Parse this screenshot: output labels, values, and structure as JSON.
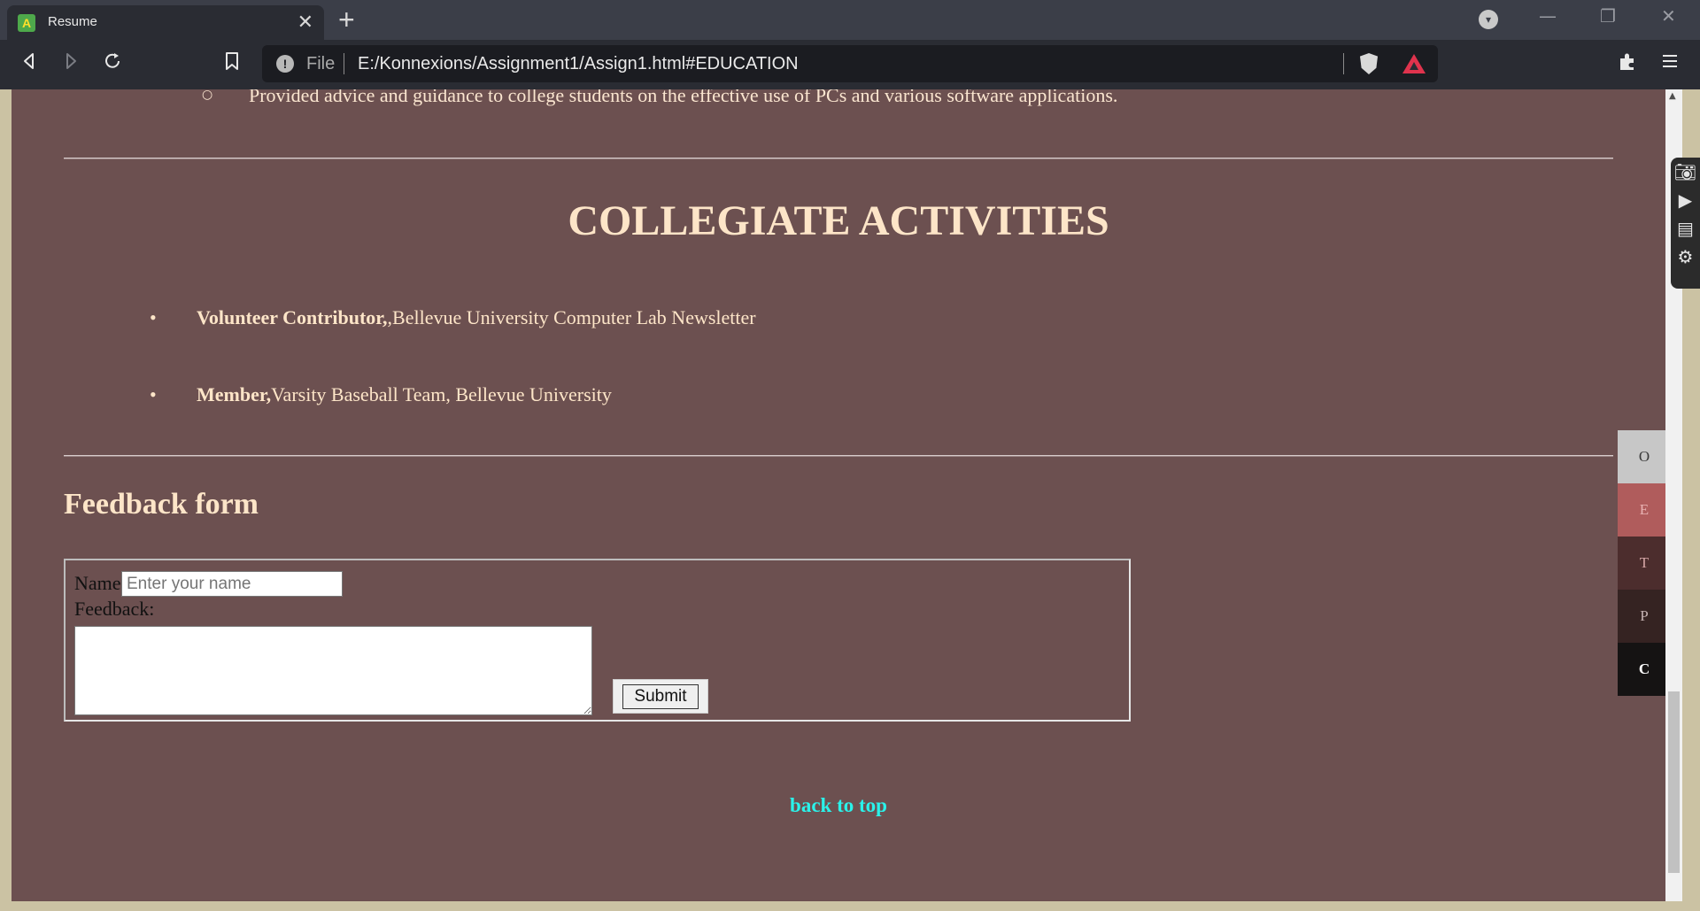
{
  "browser": {
    "tab_title": "Resume",
    "tab_favicon_letter": "A",
    "tab_close": "✕",
    "new_tab": "+",
    "url_scheme": "File",
    "url": "E:/Konnexions/Assignment1/Assign1.html#EDUCATION",
    "window_controls": {
      "dropdown": "▾",
      "minimize": "—",
      "maximize": "❐",
      "close": "✕"
    },
    "toolbar_icons": [
      "back-icon",
      "forward-icon",
      "reload-icon",
      "bookmark-icon",
      "info-icon",
      "brave-shield-icon",
      "rewards-icon",
      "extensions-icon",
      "menu-icon"
    ]
  },
  "page": {
    "sub_item": "Provided advice and guidance to college students on the effective use of PCs and various software applications.",
    "section_title": "COLLEGIATE ACTIVITIES",
    "activities": [
      {
        "role": "Volunteer Contributor,",
        "detail": ",Bellevue University Computer Lab Newsletter"
      },
      {
        "role": "Member,",
        "detail": "Varsity Baseball Team, Bellevue University"
      }
    ],
    "feedback": {
      "title": "Feedback form",
      "name_label": "Name",
      "name_placeholder": "Enter your name",
      "feedback_label": "Feedback:",
      "submit_label": "Submit"
    },
    "back_to_top": "back to top"
  },
  "side_nav": [
    {
      "letter": "O",
      "bg": "#c7c7c7",
      "color": "#3a3a3a"
    },
    {
      "letter": "E",
      "bg": "#b05c5c",
      "color": "#e9b3b3"
    },
    {
      "letter": "T",
      "bg": "#4c2d2d",
      "color": "#d6a7a7"
    },
    {
      "letter": "P",
      "bg": "#352322",
      "color": "#c4b1b1"
    },
    {
      "letter": "C",
      "bg": "#151313",
      "color": "#ffffff"
    }
  ],
  "colors": {
    "page_bg": "#6c5050",
    "heading": "#fde5c8",
    "link": "#2af2ea"
  }
}
